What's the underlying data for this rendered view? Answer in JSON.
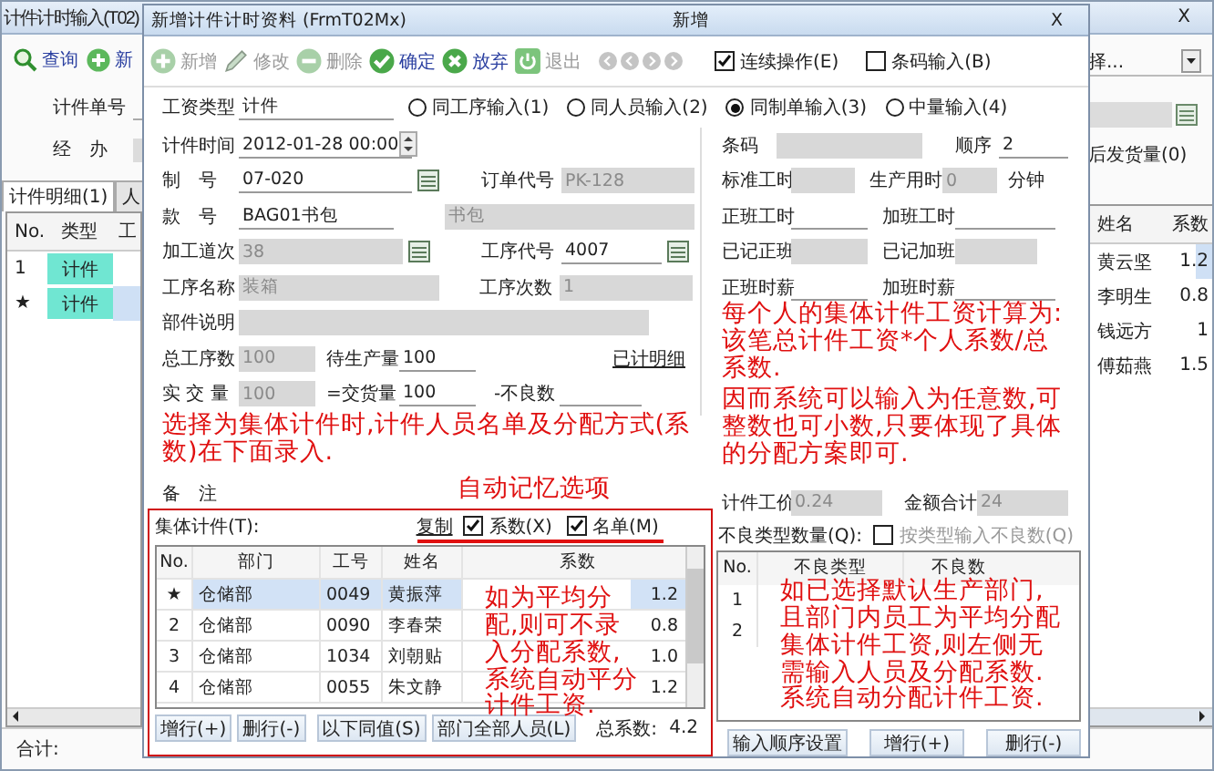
{
  "back_window": {
    "title": "计件计时输入(T02)",
    "close": "X",
    "toolbar": [
      {
        "label": "查询",
        "kind": "search"
      },
      {
        "label": "新",
        "kind": "add"
      }
    ],
    "fields": [
      {
        "label": "计件单号",
        "readonly": false
      },
      {
        "label": "经　办",
        "readonly": true
      }
    ],
    "select_value": "择...",
    "option_label": "后发货量(0)",
    "tabs": [
      {
        "label": "计件明细(1)",
        "selected": true
      },
      {
        "label": "人",
        "selected": false
      }
    ],
    "left_table": {
      "columns": [
        "No.",
        "类型",
        "工"
      ],
      "rows": [
        {
          "no": "1",
          "type": "计件",
          "selected": false
        },
        {
          "no": "★",
          "type": "计件",
          "selected": true
        }
      ]
    },
    "right_table": {
      "columns": [
        "姓名",
        "系数"
      ],
      "rows": [
        {
          "name": "黄云坚",
          "coef": "1.2",
          "selected": true
        },
        {
          "name": "李明生",
          "coef": "0.8",
          "selected": false
        },
        {
          "name": "钱远方",
          "coef": "1",
          "selected": false
        },
        {
          "name": "傅茹燕",
          "coef": "1.5",
          "selected": false
        }
      ]
    },
    "total_label": "合计:"
  },
  "dialog": {
    "title": "新增计件计时资料 (FrmT02Mx)",
    "mode": "新增",
    "close": "X",
    "toolbar": [
      {
        "label": "新增",
        "kind": "add",
        "disabled": true
      },
      {
        "label": "修改",
        "kind": "edit",
        "disabled": true
      },
      {
        "label": "删除",
        "kind": "delete",
        "disabled": true
      },
      {
        "label": "确定",
        "kind": "ok",
        "disabled": false
      },
      {
        "label": "放弃",
        "kind": "cancel",
        "disabled": false
      },
      {
        "label": "退出",
        "kind": "exit",
        "disabled": true
      }
    ],
    "options": [
      {
        "label": "连续操作(E)",
        "checked": true
      },
      {
        "label": "条码输入(B)",
        "checked": false
      }
    ],
    "wage_type": {
      "label": "工资类型",
      "value": "计件"
    },
    "input_modes": [
      {
        "label": "同工序输入(1)",
        "selected": false
      },
      {
        "label": "同人员输入(2)",
        "selected": false
      },
      {
        "label": "同制单输入(3)",
        "selected": true
      },
      {
        "label": "中量输入(4)",
        "selected": false
      }
    ],
    "left_rows": [
      [
        {
          "kind": "date",
          "label": "计件时间",
          "value": "2012-01-28 00:00",
          "readonly": false
        }
      ],
      [
        {
          "kind": "field",
          "label": "制　号",
          "value": "07-020",
          "readonly": false,
          "picker": true
        },
        {
          "kind": "field",
          "label": "订单代号",
          "value": "PK-128",
          "readonly": true
        }
      ],
      [
        {
          "kind": "field",
          "label": "款　号",
          "value": "BAG01书包",
          "readonly": false
        },
        {
          "kind": "field",
          "value": "书包",
          "readonly": true
        }
      ],
      [
        {
          "kind": "field",
          "label": "加工道次",
          "value": "38",
          "readonly": true,
          "picker": true
        },
        {
          "kind": "field",
          "label": "工序代号",
          "value": "4007",
          "readonly": false,
          "picker": true
        }
      ],
      [
        {
          "kind": "field",
          "label": "工序名称",
          "value": "装箱",
          "readonly": true
        },
        {
          "kind": "field",
          "label": "工序次数",
          "value": "1",
          "readonly": true
        }
      ],
      [
        {
          "kind": "field",
          "label": "部件说明",
          "readonly": true
        }
      ],
      [
        {
          "kind": "field",
          "label": "总工序数",
          "value": "100",
          "readonly": true
        },
        {
          "kind": "field",
          "label": "待生产量",
          "value": "100",
          "readonly": false
        },
        {
          "kind": "link",
          "label": "已计明细"
        }
      ],
      [
        {
          "kind": "field",
          "label": "实 交 量",
          "value": "100",
          "readonly": true
        },
        {
          "kind": "field",
          "label": "=交货量",
          "value": "100",
          "readonly": false
        },
        {
          "kind": "field",
          "label": "-不良数",
          "readonly": false
        }
      ]
    ],
    "remark_label": "备　注",
    "right_rows": [
      [
        {
          "kind": "field",
          "label": "条码",
          "readonly": true
        },
        {
          "kind": "field",
          "label": "顺序",
          "value": "2",
          "readonly": false
        }
      ],
      [
        {
          "kind": "field",
          "label": "标准工时",
          "readonly": true
        },
        {
          "kind": "field",
          "label": "生产用时",
          "value": "0",
          "readonly": true
        },
        {
          "kind": "unit",
          "label": "分钟"
        }
      ],
      [
        {
          "kind": "field",
          "label": "正班工时",
          "readonly": false
        },
        {
          "kind": "field",
          "label": "加班工时",
          "readonly": false
        }
      ],
      [
        {
          "kind": "field",
          "label": "已记正班",
          "readonly": true
        },
        {
          "kind": "field",
          "label": "已记加班",
          "readonly": true
        }
      ],
      [
        {
          "kind": "field",
          "label": "正班时薪",
          "readonly": false
        },
        {
          "kind": "field",
          "label": "加班时薪",
          "readonly": false
        }
      ]
    ],
    "price_row": [
      {
        "label": "计件工价",
        "value": "0.24",
        "readonly": true
      },
      {
        "label": "金额合计",
        "value": "24",
        "readonly": true
      }
    ],
    "group": {
      "label": "集体计件(T):",
      "copy_label": "复制",
      "copy_options": [
        {
          "label": "系数(X)",
          "checked": true
        },
        {
          "label": "名单(M)",
          "checked": true
        }
      ],
      "columns": [
        "No.",
        "部门",
        "工号",
        "姓名",
        "系数"
      ],
      "rows": [
        {
          "no": "★",
          "dept": "仓储部",
          "id": "0049",
          "name": "黄振萍",
          "coef": "1.2",
          "selected": true
        },
        {
          "no": "2",
          "dept": "仓储部",
          "id": "0090",
          "name": "李春荣",
          "coef": "0.8",
          "selected": false
        },
        {
          "no": "3",
          "dept": "仓储部",
          "id": "1034",
          "name": "刘朝贴",
          "coef": "1.0",
          "selected": false
        },
        {
          "no": "4",
          "dept": "仓储部",
          "id": "0055",
          "name": "朱文静",
          "coef": "1.2",
          "selected": false
        }
      ],
      "buttons": [
        "增行(+)",
        "删行(-)",
        "以下同值(S)",
        "部门全部人员(L)"
      ],
      "total_label": "总系数:",
      "total": "4.2"
    },
    "defects": {
      "label": "不良类型数量(Q):",
      "by_type": {
        "label": "按类型输入不良数(Q)",
        "checked": false,
        "disabled": true
      },
      "columns": [
        "No.",
        "不良类型",
        "不良数"
      ],
      "rows": [
        {
          "no": "1"
        },
        {
          "no": "2"
        }
      ],
      "buttons": [
        "输入顺序设置",
        "增行(+)",
        "删行(-)"
      ]
    }
  },
  "annotations": [
    {
      "text": "选择为集体计件时,计件人员名单及分配方式(系数)在下面录入."
    },
    {
      "text": "自动记忆选项"
    },
    {
      "text": "每个人的集体计件工资计算为:该笔总计件工资*个人系数/总系数."
    },
    {
      "text": "因而系统可以输入为任意数,可整数也可小数,只要体现了具体的分配方案即可."
    },
    {
      "text": "如为平均分配,则可不录入分配系数,系统自动平分计件工资."
    },
    {
      "text": "如已选择默认生产部门,且部门内员工为平均分配集体计件工资,则左侧无需输入人员及分配系数.系统自动分配计件工资."
    }
  ]
}
